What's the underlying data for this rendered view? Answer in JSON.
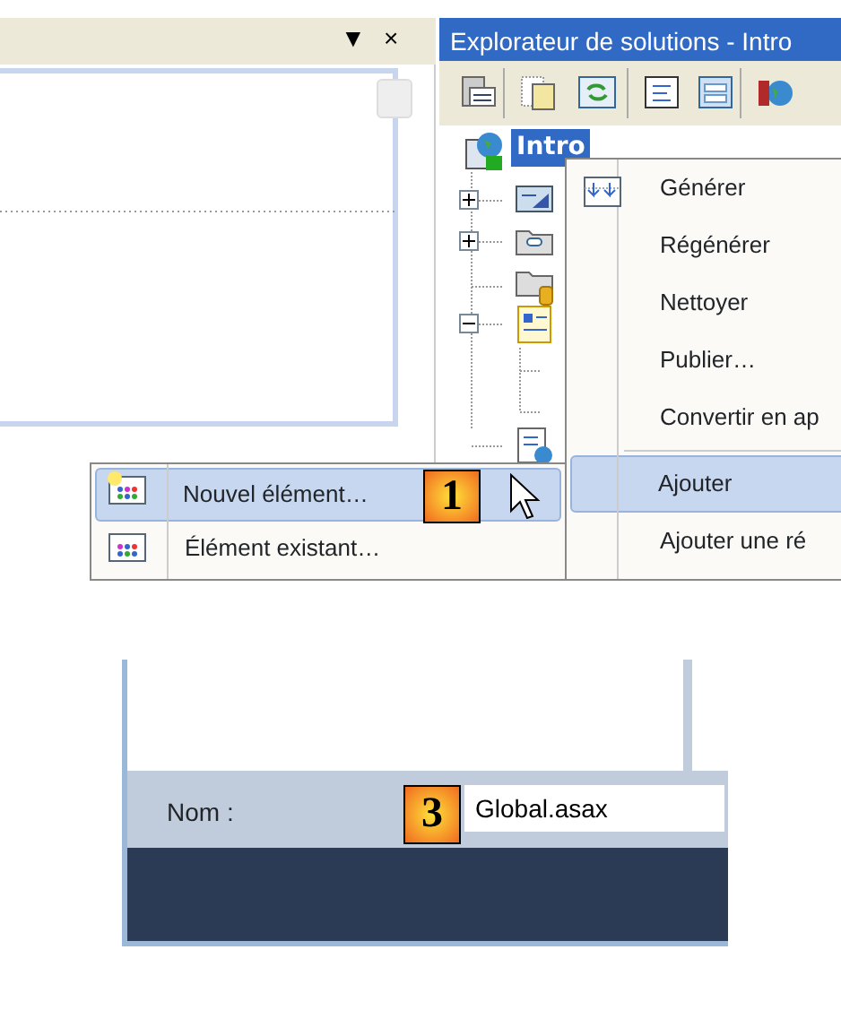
{
  "editor_pane": {
    "header_buttons": [
      "▼",
      "×"
    ]
  },
  "solution_explorer": {
    "title": "Explorateur de solutions - Intro",
    "tree": [
      {
        "label": "Intro",
        "selected": true,
        "children": [
          {
            "expanded": false,
            "kind": "form"
          },
          {
            "expanded": false,
            "kind": "folder"
          },
          {
            "kind": "database-folder"
          },
          {
            "expanded": true,
            "kind": "page"
          },
          {
            "kind": "web-file"
          }
        ]
      }
    ]
  },
  "context_menu": {
    "items": [
      {
        "label": "Générer",
        "selected": false,
        "icon": true
      },
      {
        "label": "Régénérer",
        "selected": false
      },
      {
        "label": "Nettoyer",
        "selected": false
      },
      {
        "label": "Publier…",
        "selected": false
      },
      {
        "label": "Convertir en ap",
        "selected": false,
        "separator_after": true
      },
      {
        "label": "Ajouter",
        "selected": true
      },
      {
        "label": "Ajouter une ré",
        "selected": false
      }
    ]
  },
  "submenu": {
    "items": [
      {
        "label": "Nouvel élément…",
        "selected": true
      },
      {
        "label": "Élément existant…",
        "selected": false
      }
    ]
  },
  "callouts": [
    "1",
    "3"
  ],
  "dialog": {
    "name_label": "Nom :",
    "name_value": "Global.asax"
  }
}
